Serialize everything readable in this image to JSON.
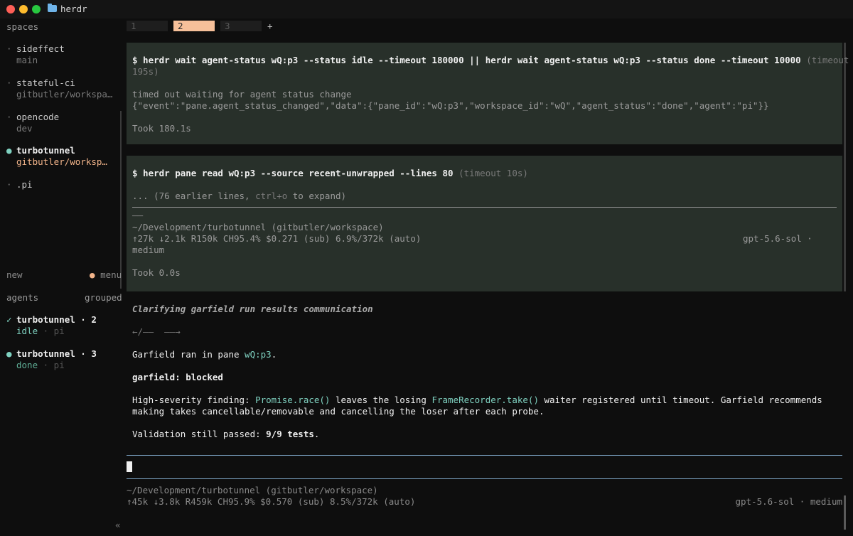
{
  "window": {
    "title": "herdr"
  },
  "sidebar": {
    "spaces_heading": "spaces",
    "spaces": [
      {
        "name": "sideffect",
        "branch": "main"
      },
      {
        "name": "stateful-ci",
        "branch": "gitbutler/workspa…"
      },
      {
        "name": "opencode",
        "branch": "dev"
      },
      {
        "name": "turbotunnel",
        "branch": "gitbutler/worksp…"
      },
      {
        "name": ".pi",
        "branch": ""
      }
    ],
    "bullet": "·",
    "active_bullet": "●",
    "new_label": "new",
    "menu_label": "menu",
    "menu_dot": "●",
    "agents_heading": "agents",
    "grouped_label": "grouped",
    "agents": [
      {
        "check": "✓",
        "name": "turbotunnel · 2",
        "status": "idle",
        "agent": " · pi"
      },
      {
        "check": "●",
        "name": "turbotunnel · 3",
        "status": "done",
        "agent": " · pi"
      }
    ],
    "collapse_glyph": "«"
  },
  "tabs": {
    "items": [
      "1",
      "2",
      "3"
    ],
    "active": "2",
    "add": "+"
  },
  "block1": {
    "cmd_line1": "$ herdr wait agent-status wQ:p3 --status idle --timeout 180000 || herdr wait agent-status wQ:p3 --status done --timeout 10000",
    "cmd_suffix": " (timeout",
    "cmd_line2": "195s)",
    "out_line1": "timed out waiting for agent status change",
    "out_line2": "{\"event\":\"pane.agent_status_changed\",\"data\":{\"pane_id\":\"wQ:p3\",\"workspace_id\":\"wQ\",\"agent_status\":\"done\",\"agent\":\"pi\"}}",
    "took": "Took 180.1s"
  },
  "block2": {
    "cmd": "$ herdr pane read wQ:p3 --source recent-unwrapped --lines 80",
    "cmd_suffix": " (timeout 10s)",
    "earlier_a": "... (76 earlier lines, ",
    "earlier_b": "ctrl+o",
    "earlier_c": " to expand)",
    "dash": "──",
    "path": "~/Development/turbotunnel (gitbutler/workspace)",
    "stats": "↑27k ↓2.1k R150k CH95.4% $0.271 (sub) 6.9%/372k (auto)",
    "model": "gpt-5.6-sol ·",
    "effort": "medium",
    "took": "Took 0.0s"
  },
  "message": {
    "heading": "Clarifying garfield run results communication",
    "arrows": "←/——  ——→",
    "ran_a": "Garfield ran in pane ",
    "ran_pane": "wQ:p3",
    "ran_b": ".",
    "status": "garfield: blocked",
    "finding_a": "High-severity finding: ",
    "finding_code1": "Promise.race()",
    "finding_b": " leaves the losing ",
    "finding_code2": "FrameRecorder.take()",
    "finding_c": " waiter registered until timeout. Garfield recommends",
    "finding_line2": "making takes cancellable/removable and cancelling the loser after each probe.",
    "validation_a": "Validation still passed: ",
    "validation_b": "9/9 tests",
    "validation_c": "."
  },
  "footer": {
    "path": "~/Development/turbotunnel (gitbutler/workspace)",
    "stats": "↑45k ↓3.8k R459k CH95.9% $0.570 (sub) 8.5%/372k (auto)",
    "model": "gpt-5.6-sol · medium"
  }
}
